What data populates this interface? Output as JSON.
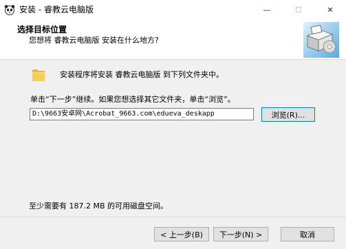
{
  "window": {
    "title": "安装 - 睿教云电脑版",
    "minimize_glyph": "—",
    "maximize_glyph": "☐",
    "close_glyph": "✕"
  },
  "header": {
    "title": "选择目标位置",
    "subtitle": "您想将 睿教云电脑版 安装在什么地方?"
  },
  "content": {
    "intro": "安装程序将安装 睿教云电脑版 到下列文件夹中。",
    "instruction": "单击“下一步”继续。如果您想选择其它文件夹，单击“浏览”。",
    "path_value": "D:\\9663安卓网\\Acrobat_9663.com\\edueva_deskapp",
    "browse_label": "浏览(R)...",
    "space_required": "至少需要有 187.2 MB 的可用磁盘空间。"
  },
  "footer": {
    "back_label": "< 上一步(B)",
    "next_label": "下一步(N) >",
    "cancel_label": "取消"
  },
  "icons": {
    "app": "panda-icon",
    "folder": "folder-icon",
    "header": "installer-box-icon"
  },
  "colors": {
    "accent": "#0078d7",
    "panel": "#f0f0f0"
  }
}
